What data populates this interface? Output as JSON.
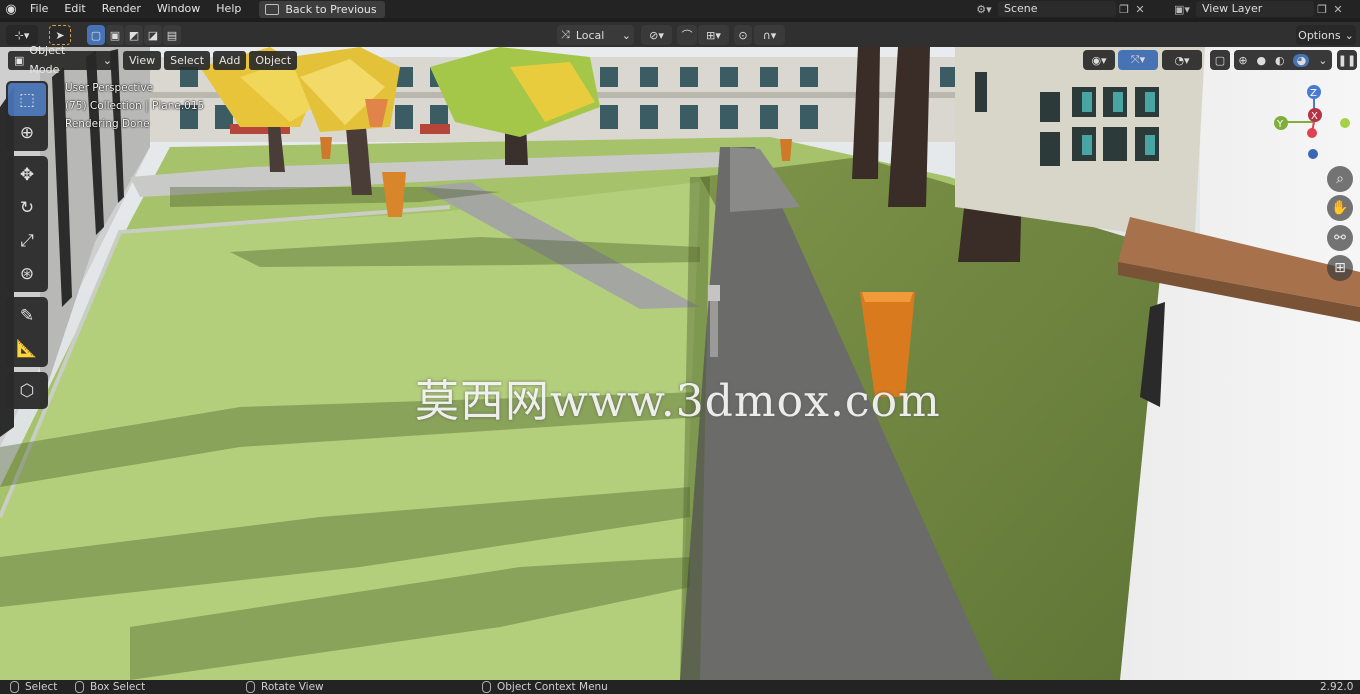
{
  "menu": {
    "items": [
      "File",
      "Edit",
      "Render",
      "Window",
      "Help"
    ],
    "back_label": "Back to Previous"
  },
  "scene": {
    "scene_name": "Scene",
    "view_layer": "View Layer"
  },
  "toolbar": {
    "orientation": "Local",
    "options_label": "Options"
  },
  "viewport_header": {
    "mode": "Object Mode",
    "view": "View",
    "select": "Select",
    "add": "Add",
    "object": "Object"
  },
  "overlay": {
    "line1": "User Perspective",
    "line2": "(75) Collection | Plane.015",
    "line3": "Rendering Done"
  },
  "gizmo": {
    "x": "X",
    "y": "Y",
    "z": "Z"
  },
  "watermark": "莫西网www.3dmox.com",
  "status": {
    "select": "Select",
    "box_select": "Box Select",
    "rotate_view": "Rotate View",
    "context_menu": "Object Context Menu",
    "version": "2.92.0"
  },
  "colors": {
    "accent": "#4772b3",
    "grass": "#a6c26b",
    "path": "#6b6b69",
    "tree_foliage": "#e3c23a",
    "trunk": "#3a2c26",
    "bin": "#d97a1e"
  }
}
